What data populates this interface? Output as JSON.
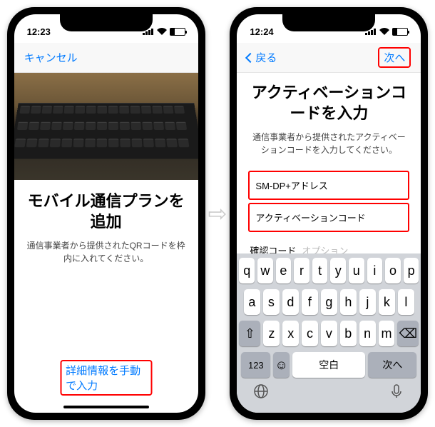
{
  "left": {
    "time": "12:23",
    "nav_cancel": "キャンセル",
    "title": "モバイル通信プランを追加",
    "subtitle": "通信事業者から提供されたQRコードを枠内に入れてください。",
    "manual_entry": "詳細情報を手動で入力"
  },
  "right": {
    "time": "12:24",
    "nav_back": "戻る",
    "nav_next": "次へ",
    "title": "アクティベーションコードを入力",
    "subtitle": "通信事業者から提供されたアクティベーションコードを入力してください。",
    "field1": "SM-DP+アドレス",
    "field2": "アクティベーションコード",
    "field3": "確認コード",
    "field3_opt": "オプション"
  },
  "keyboard": {
    "row1": [
      "q",
      "w",
      "e",
      "r",
      "t",
      "y",
      "u",
      "i",
      "o",
      "p"
    ],
    "row2": [
      "a",
      "s",
      "d",
      "f",
      "g",
      "h",
      "j",
      "k",
      "l"
    ],
    "row3": [
      "z",
      "x",
      "c",
      "v",
      "b",
      "n",
      "m"
    ],
    "num": "123",
    "space": "空白",
    "next": "次へ"
  }
}
